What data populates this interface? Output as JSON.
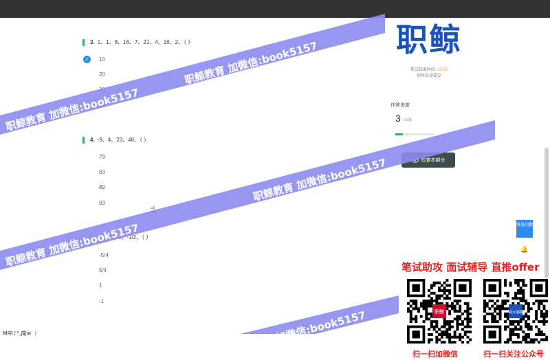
{
  "brand": {
    "logo_text": "职鲸"
  },
  "questions": [
    {
      "number": "3.",
      "text": "1、1、8、16、7、21、4、16、2、（ ）",
      "options": [
        "10",
        "20",
        "30",
        "40"
      ],
      "selected": 0
    },
    {
      "number": "4.",
      "text": "-9、4、23、48、（ ）",
      "options": [
        "79",
        "83",
        "89",
        "93"
      ]
    },
    {
      "number": "5.",
      "text": "-1、-4、3、-1/2、（ ）",
      "options": [
        "-5/4",
        "5/4",
        "1",
        "-1"
      ]
    }
  ],
  "sidebar": {
    "timer_label": "笔试结束时间:",
    "timer_value": "10:50",
    "auto_submit": "到时自动提交",
    "progress_label": "作答进度",
    "progress_value": "3",
    "progress_total": "/15题",
    "progress_fraction": 0.2,
    "check_button": "检查本部分"
  },
  "feedback_button": "常见问题",
  "promo": {
    "headline": "笔试助攻  面试辅导  直推offer",
    "qr_wechat_caption": "扫一扫加微信",
    "qr_wechat_badge": "职鲸",
    "qr_official_caption": "扫一扫关注公众号",
    "qr_official_badge": "四大招聘"
  },
  "watermark_text": "职鲸教育 加微信:book5157",
  "ime_toolbar": "M中♪°,简⊛ ⋮",
  "colors": {
    "accent_green": "#36b36a",
    "accent_blue": "#2d8cf0",
    "logo_blue": "#1b53b8",
    "promo_red": "#e52020",
    "watermark": "#8c8cf0"
  }
}
